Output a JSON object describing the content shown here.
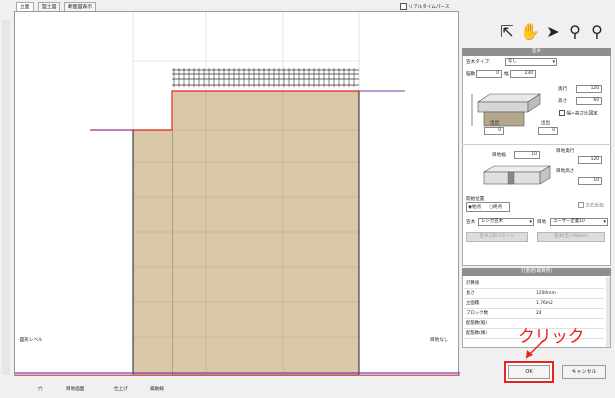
{
  "tabs": [
    {
      "label": "立面"
    },
    {
      "label": "竪土図"
    },
    {
      "label": "断面図表示"
    }
  ],
  "realtime_perspective": {
    "label": "リアルタイムパース",
    "checked": false
  },
  "canvas": {
    "left_level_label": "-図形レベル",
    "right_level_label": "目地なし"
  },
  "tool_icons": [
    "select-arrow-icon",
    "hand-pan-icon",
    "pointer-icon",
    "pin-add-icon",
    "pin-remove-icon"
  ],
  "panel": {
    "header": "笠木",
    "kasagi_type_label": "笠木タイプ:",
    "kasagi_type_value": "なし",
    "mekuri_label": "脳勲",
    "mekuri_value": "0",
    "width_label": "幅",
    "width_value": "230",
    "depth_label": "奥行",
    "depth_value": "120",
    "height_label": "高さ",
    "height_value": "60",
    "same_checkbox_label": "幅=高さ比固定",
    "dekake_label": "出出",
    "dekake_value": "0",
    "dekake2_label": "出出",
    "dekake2_value": "0",
    "joint_width_label": "目地幅",
    "joint_width_value": "10",
    "joint_depth_label": "目地奥行",
    "joint_depth_value": "120",
    "joint_height_label": "目地高さ",
    "joint_height_value": "10",
    "start_pos_label": "開始位置",
    "start_option": "始点",
    "end_option": "終点",
    "flip_label": "左右反転",
    "kasagi_label": "笠木",
    "kasagi_select": "レンガ笠木",
    "joint_label": "目地",
    "joint_select": "ユーザー定義10",
    "btn_pattern": "笠木コ形パターン",
    "btn_all": "笠木(全) Pattern"
  },
  "quantities": {
    "header": "計量値(概算用)",
    "rows": [
      {
        "key": "計算値",
        "value": ""
      },
      {
        "key": "長さ",
        "value": "1200mm"
      },
      {
        "key": "立面積",
        "value": "1.76m2"
      },
      {
        "key": "ブロック数",
        "value": "24"
      },
      {
        "key": "配筋数(縦)",
        "value": ""
      },
      {
        "key": "配筋数(横)",
        "value": ""
      }
    ]
  },
  "annotation": {
    "text": "クリック",
    "color": "#e8231f"
  },
  "actions": {
    "ok": "OK",
    "cancel": "キャンセル"
  },
  "bottom_tabs": [
    "穴",
    "目地画面",
    "仕上げ",
    "補助線"
  ],
  "colors": {
    "wall": "#d8c8a8",
    "ground": "#7a3aa8",
    "red": "#e8231f"
  }
}
